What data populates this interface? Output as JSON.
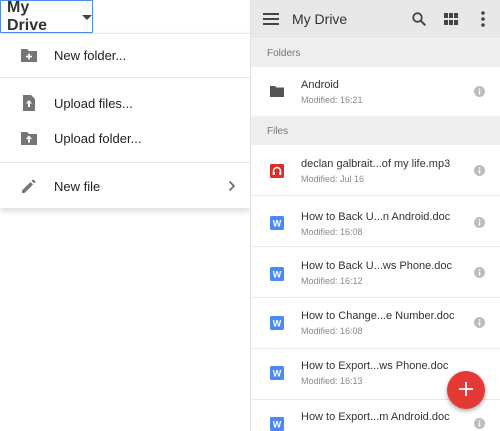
{
  "desktop": {
    "drive_button_label": "My Drive",
    "menu": {
      "new_folder": "New folder...",
      "upload_files": "Upload files...",
      "upload_folder": "Upload folder...",
      "new_file": "New file"
    }
  },
  "mobile": {
    "title": "My Drive",
    "sections": {
      "folders": "Folders",
      "files": "Files"
    },
    "folders": [
      {
        "name": "Android",
        "modified": "Modified: 16:21"
      }
    ],
    "files": [
      {
        "name": "declan galbrait...of my life.mp3",
        "modified": "Modified: Jul 16",
        "type": "audio"
      },
      {
        "name": "How to Back U...n Android.doc",
        "modified": "Modified: 16:08",
        "type": "doc"
      },
      {
        "name": "How to Back U...ws Phone.doc",
        "modified": "Modified: 16:12",
        "type": "doc"
      },
      {
        "name": "How to Change...e Number.doc",
        "modified": "Modified: 16:08",
        "type": "doc"
      },
      {
        "name": "How to Export...ws Phone.doc",
        "modified": "Modified: 16:13",
        "type": "doc"
      },
      {
        "name": "How to Export...m Android.doc",
        "modified": "",
        "type": "doc"
      }
    ],
    "fab_label": "+"
  },
  "colors": {
    "accent_blue": "#4a8af4",
    "doc_blue": "#4a8af4",
    "audio_red": "#d93025",
    "fab_red": "#e53935"
  }
}
